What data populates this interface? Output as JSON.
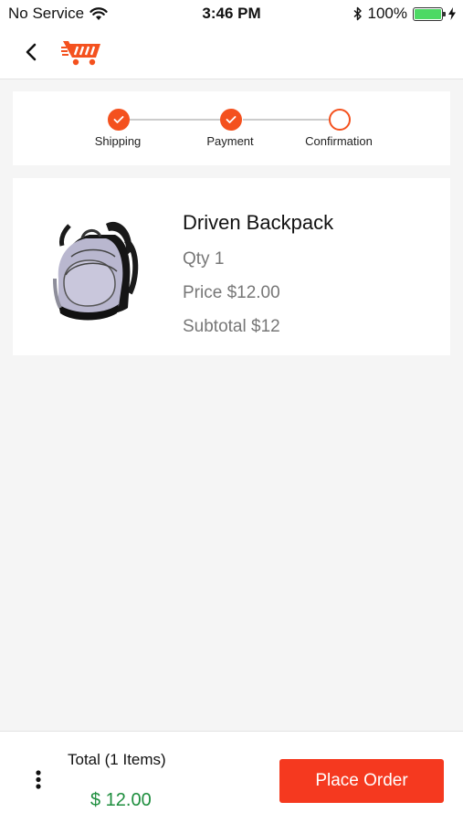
{
  "status_bar": {
    "carrier": "No Service",
    "time": "3:46 PM",
    "battery": "100%",
    "battery_level": 1.0,
    "icons": [
      "wifi-icon",
      "bluetooth-icon",
      "battery-icon",
      "charging-icon"
    ]
  },
  "nav": {
    "back_icon": "chevron-left-icon",
    "logo_icon": "shopping-cart-logo"
  },
  "stepper": {
    "steps": [
      {
        "label": "Shipping",
        "state": "done"
      },
      {
        "label": "Payment",
        "state": "done"
      },
      {
        "label": "Confirmation",
        "state": "pending"
      }
    ]
  },
  "product": {
    "name": "Driven Backpack",
    "qty": "Qty 1",
    "price": "Price $12.00",
    "subtotal": "Subtotal $12",
    "image_icon": "backpack-image"
  },
  "footer": {
    "total_label": "Total (1 Items)",
    "total_value": "$ 12.00",
    "place_order_label": "Place Order",
    "more_icon": "more-vertical-icon"
  },
  "colors": {
    "accent": "#f4511e",
    "button": "#f5391f",
    "total": "#1e8e3e",
    "battery": "#4cd964"
  }
}
